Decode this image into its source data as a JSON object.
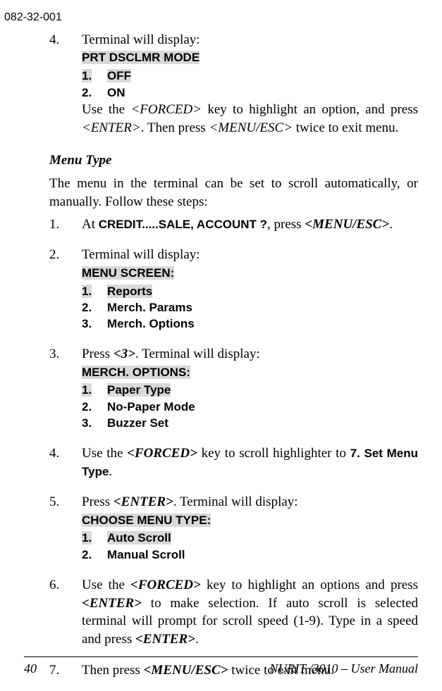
{
  "doc_id": "082-32-001",
  "step4": {
    "num": "4.",
    "intro": "Terminal will display:",
    "line1a": "PRT DSCLMR MODE",
    "line2a": "1.",
    "line2b": "OFF",
    "line3a": "2.",
    "line3b": "ON",
    "body1a": "Use the ",
    "body1b": "<FORCED>",
    "body1c": " key to highlight an option, and press ",
    "body1d": "<ENTER>",
    "body1e": ".  Then press ",
    "body1f": "<MENU/ESC>",
    "body1g": " twice to exit menu."
  },
  "menu_type_heading": "Menu Type",
  "menu_type_para": "The menu in the terminal can be set to scroll automatically, or manually. Follow these steps:",
  "m1": {
    "num": "1.",
    "a": "At  ",
    "b": "CREDIT.....SALE, ACCOUNT ?",
    "c": ", press ",
    "d": "<MENU/ESC>",
    "e": "."
  },
  "m2": {
    "num": "2.",
    "intro": "Terminal will display:",
    "t1": "MENU SCREEN:",
    "s1a": "1.",
    "s1b": "Reports",
    "s2a": "2.",
    "s2b": "Merch. Params",
    "s3a": "3.",
    "s3b": "Merch. Options"
  },
  "m3": {
    "num": "3.",
    "a": "Press ",
    "b": "<3>",
    "c": ". Terminal will display:",
    "t1": "MERCH. OPTIONS:",
    "s1a": "1.",
    "s1b": "Paper Type",
    "s2a": "2.",
    "s2b": "No-Paper Mode",
    "s3a": "3.",
    "s3b": "Buzzer Set"
  },
  "m4": {
    "num": "4.",
    "a": "Use the ",
    "b": "<FORCED>",
    "c": " key to scroll highlighter to ",
    "d": "7. Set Menu Type",
    "e": "."
  },
  "m5": {
    "num": "5.",
    "a": "Press ",
    "b": "<ENTER>",
    "c": ". Terminal will display:",
    "t1": "CHOOSE MENU TYPE:",
    "s1a": "1.",
    "s1b": "Auto Scroll",
    "s2a": "2.",
    "s2b": "Manual Scroll"
  },
  "m6": {
    "num": "6.",
    "a": "Use the ",
    "b": "<FORCED>",
    "c": " key to highlight an options and press ",
    "d": "<ENTER>",
    "e": " to make selection.  If auto scroll is selected terminal will prompt for scroll speed (1-9).  Type in a speed and press ",
    "f": "<ENTER>",
    "g": "."
  },
  "m7": {
    "num": "7.",
    "a": "Then press ",
    "b": "<MENU/ESC>",
    "c": " twice to exit menu."
  },
  "footer": {
    "page": "40",
    "title_a": "NURIT /3010 ",
    "title_b": "⎯",
    "title_c": " User Manual"
  }
}
